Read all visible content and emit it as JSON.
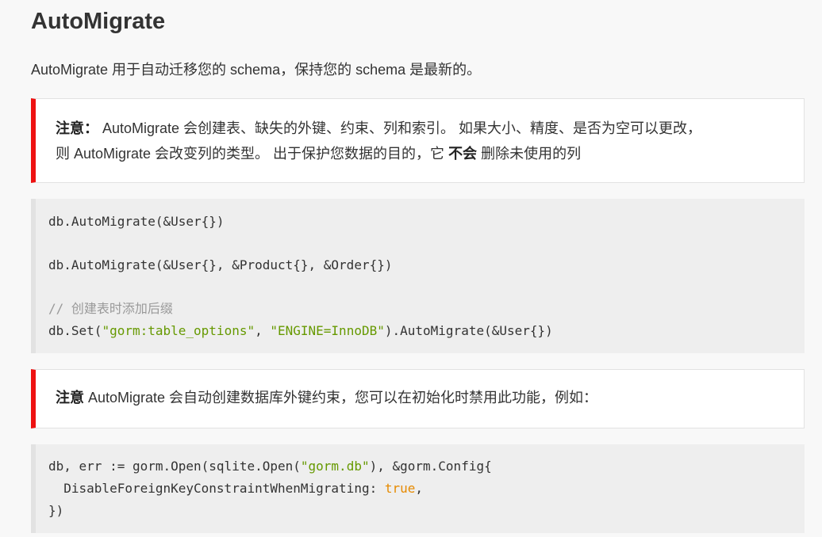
{
  "heading": "AutoMigrate",
  "intro": "AutoMigrate 用于自动迁移您的 schema，保持您的 schema 是最新的。",
  "note1": {
    "label": "注意：",
    "line1": " AutoMigrate 会创建表、缺失的外键、约束、列和索引。 如果大小、精度、是否为空可以更改，",
    "line2_pre": "则 AutoMigrate 会改变列的类型。 出于保护您数据的目的，它 ",
    "line2_bold": "不会",
    "line2_post": " 删除未使用的列"
  },
  "code1": {
    "l1": "db.AutoMigrate(&User{})",
    "l2": "db.AutoMigrate(&User{}, &Product{}, &Order{})",
    "comment": "// 创建表时添加后缀",
    "l4_pre": "db.Set(",
    "l4_str1": "\"gorm:table_options\"",
    "l4_mid": ", ",
    "l4_str2": "\"ENGINE=InnoDB\"",
    "l4_post": ").AutoMigrate(&User{})"
  },
  "note2": {
    "label": "注意",
    "text": " AutoMigrate 会自动创建数据库外键约束，您可以在初始化时禁用此功能，例如："
  },
  "code2": {
    "l1_pre": "db, err := gorm.Open(sqlite.Open(",
    "l1_str": "\"gorm.db\"",
    "l1_post": "), &gorm.Config{",
    "l2_pre": "  DisableForeignKeyConstraintWhenMigrating: ",
    "l2_kw": "true",
    "l2_post": ",",
    "l3": "})"
  }
}
